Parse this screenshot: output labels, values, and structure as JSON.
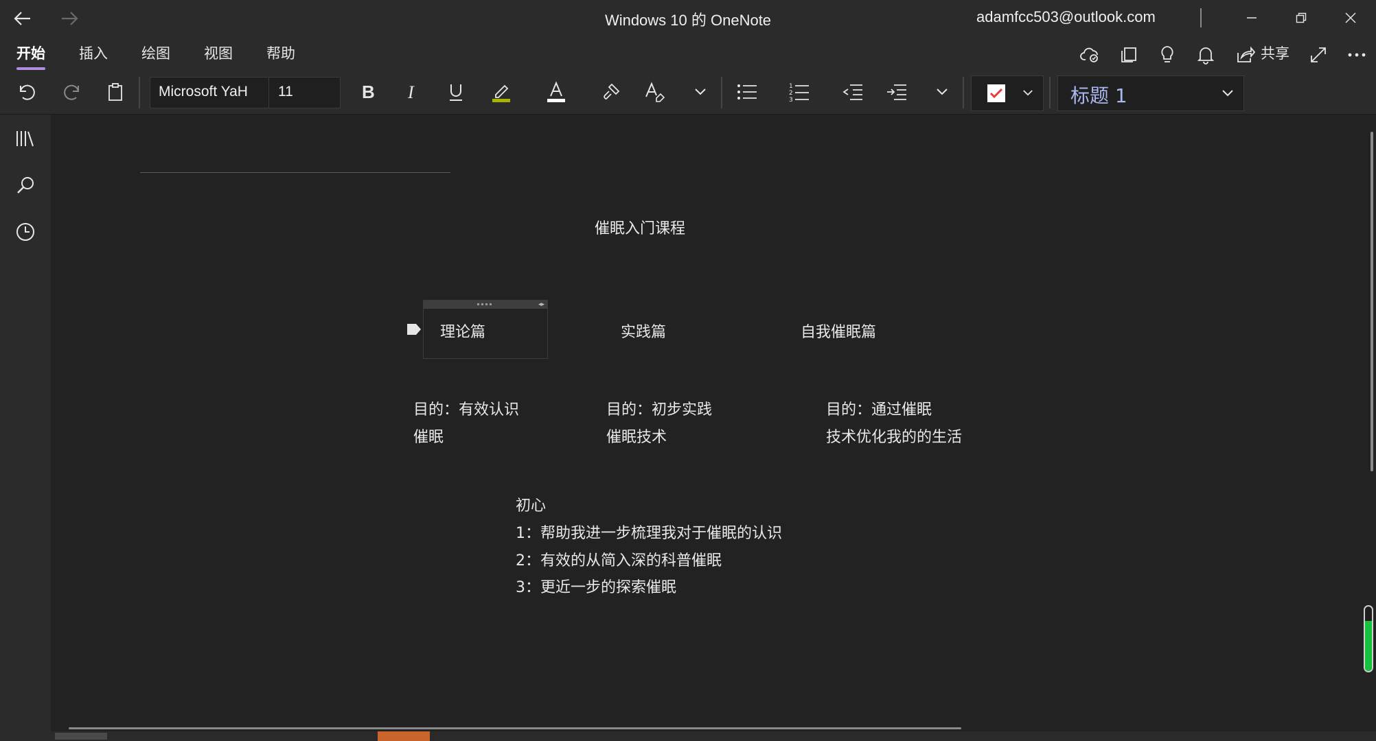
{
  "window": {
    "title": "Windows 10 的 OneNote",
    "account": "adamfcc503@outlook.com"
  },
  "menu_tabs": [
    {
      "label": "开始",
      "active": true
    },
    {
      "label": "插入",
      "active": false
    },
    {
      "label": "绘图",
      "active": false
    },
    {
      "label": "视图",
      "active": false
    },
    {
      "label": "帮助",
      "active": false
    }
  ],
  "toolbar": {
    "share_label": "共享",
    "font_name": "Microsoft YaH",
    "font_size": "11",
    "style_name": "标题 1"
  },
  "colors": {
    "accent_tab": "#b58ddf",
    "highlight": "#a8b400",
    "font_color_bar": "#ffffff",
    "checkbox_red": "#e43b3b",
    "style_text": "#a9b8f0",
    "scroll_orange": "#c8642c",
    "scroll_green": "#17c33c"
  },
  "page": {
    "title": "催眠入门课程",
    "columns": [
      {
        "heading": "理论篇",
        "purpose_line1": "目的：有效认识",
        "purpose_line2": "催眠"
      },
      {
        "heading": "实践篇",
        "purpose_line1": "目的：初步实践",
        "purpose_line2": "催眠技术"
      },
      {
        "heading": "自我催眠篇",
        "purpose_line1": "目的：通过催眠",
        "purpose_line2": "技术优化我的的生活"
      }
    ],
    "intent": {
      "heading": "初心",
      "items": [
        "1：帮助我进一步梳理我对于催眠的认识",
        "2：有效的从简入深的科普催眠",
        "3：更近一步的探索催眠"
      ]
    }
  },
  "indicator_level": 0.78
}
